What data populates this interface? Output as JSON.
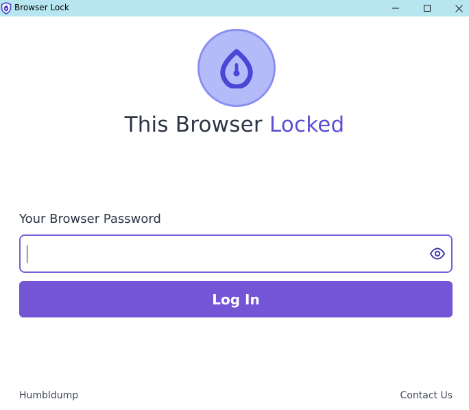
{
  "window": {
    "title": "Browser Lock",
    "app_icon": "shield-icon",
    "controls": {
      "minimize_icon": "minimize-icon",
      "maximize_icon": "maximize-icon",
      "close_icon": "close-icon"
    }
  },
  "hero": {
    "icon": "lock-shield-icon",
    "title_main": "This Browser ",
    "title_accent": "Locked"
  },
  "form": {
    "password_label": "Your Browser Password",
    "password_value": "",
    "password_placeholder": "",
    "toggle_icon": "eye-icon",
    "login_label": "Log In"
  },
  "footer": {
    "left_link": "Humbldump",
    "right_link": "Contact Us"
  },
  "colors": {
    "titlebar": "#b7e6f0",
    "accent": "#5c4fd4",
    "button": "#7455d6",
    "badge_fill": "#b5bbf9",
    "badge_border": "#8b8ef2",
    "text": "#2b3345"
  }
}
